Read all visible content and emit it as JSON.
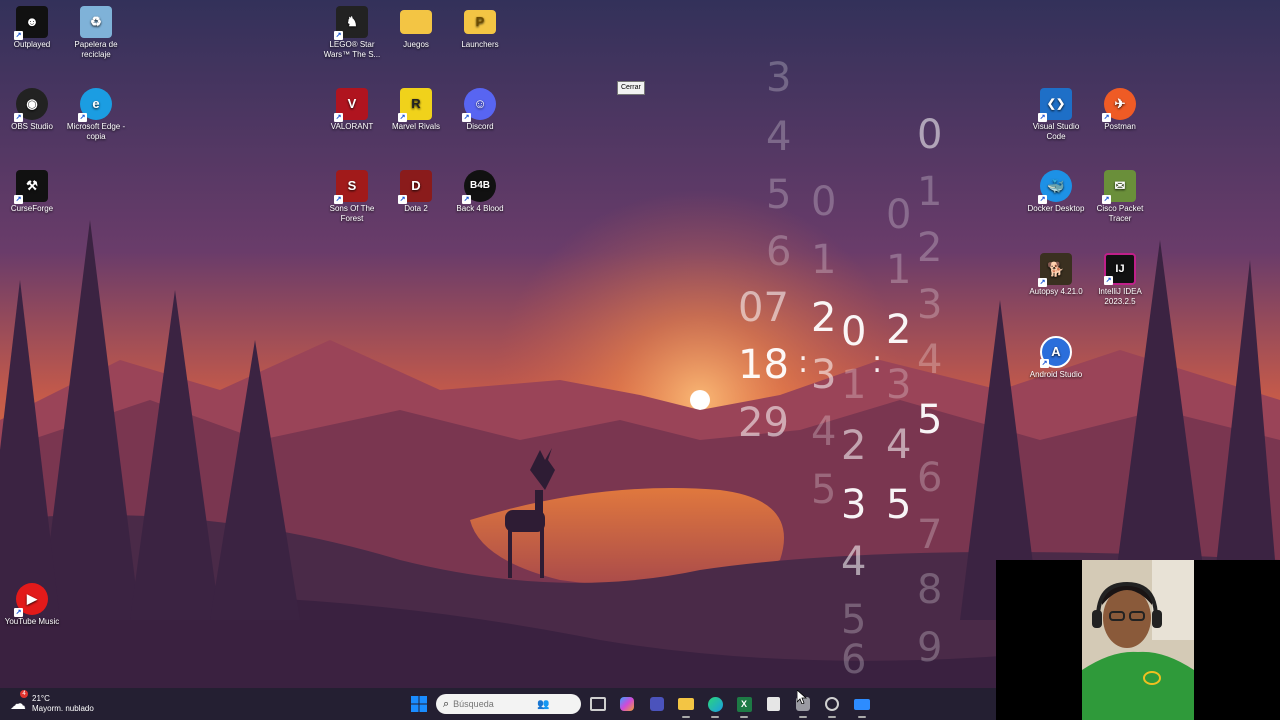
{
  "desktop": {
    "icons": [
      {
        "id": "outplayed",
        "label": "Outplayed",
        "glyph": "☻",
        "bg": "#111111"
      },
      {
        "id": "recycle",
        "label": "Papelera de reciclaje",
        "glyph": "♻",
        "bg": "#7fb2d8"
      },
      {
        "id": "obs",
        "label": "OBS Studio",
        "glyph": "◉",
        "bg": "#222222"
      },
      {
        "id": "edge-copy",
        "label": "Microsoft Edge - copia",
        "glyph": "e",
        "bg": "#1b9de2"
      },
      {
        "id": "curseforge",
        "label": "CurseForge",
        "glyph": "⚒",
        "bg": "#111111"
      },
      {
        "id": "lego",
        "label": "LEGO® Star Wars™ The S...",
        "glyph": "♞",
        "bg": "#222222"
      },
      {
        "id": "juegos",
        "label": "Juegos",
        "glyph": "",
        "bg": "#f3c544"
      },
      {
        "id": "launchers",
        "label": "Launchers",
        "glyph": "P",
        "bg": "#f3c544"
      },
      {
        "id": "valorant",
        "label": "VALORANT",
        "glyph": "V",
        "bg": "#b0141f"
      },
      {
        "id": "marvel",
        "label": "Marvel Rivals",
        "glyph": "R",
        "bg": "#f0d21b"
      },
      {
        "id": "discord",
        "label": "Discord",
        "glyph": "☺",
        "bg": "#5865f2"
      },
      {
        "id": "sons",
        "label": "Sons Of The Forest",
        "glyph": "S",
        "bg": "#a11a1a"
      },
      {
        "id": "dota",
        "label": "Dota 2",
        "glyph": "D",
        "bg": "#8a1b1b"
      },
      {
        "id": "b4b",
        "label": "Back 4 Blood",
        "glyph": "B4B",
        "bg": "#111111"
      },
      {
        "id": "vscode",
        "label": "Visual Studio Code",
        "glyph": "❮❯",
        "bg": "#1e6fc7"
      },
      {
        "id": "postman",
        "label": "Postman",
        "glyph": "✈",
        "bg": "#ef5b25"
      },
      {
        "id": "docker",
        "label": "Docker Desktop",
        "glyph": "🐳",
        "bg": "#1d91e6"
      },
      {
        "id": "cisco",
        "label": "Cisco Packet Tracer",
        "glyph": "✉",
        "bg": "#6a8f3a"
      },
      {
        "id": "autopsy",
        "label": "Autopsy 4.21.0",
        "glyph": "🐕",
        "bg": "#3a3020"
      },
      {
        "id": "intellij",
        "label": "IntelliJ IDEA 2023.2.5",
        "glyph": "IJ",
        "bg": "#111111"
      },
      {
        "id": "android",
        "label": "Android Studio",
        "glyph": "A",
        "bg": "#2b6edb"
      },
      {
        "id": "ytmusic",
        "label": "YouTube Music",
        "glyph": "▶",
        "bg": "#e21a1a"
      }
    ]
  },
  "tooltip": "Cerrar",
  "clock": {
    "hour": "18",
    "minute": "31",
    "second": "35",
    "hour_above": [
      "3",
      "4",
      "5",
      "6",
      "07"
    ],
    "hour_below": [
      "29"
    ],
    "col2": [
      "0",
      "1",
      "2",
      "3",
      "4",
      "5"
    ],
    "col3": [
      "0",
      "1",
      "2",
      "3",
      "4",
      "5"
    ],
    "col4": [
      "0",
      "1",
      "2",
      "3",
      "4",
      "5",
      "6"
    ],
    "col5": [
      "0",
      "1",
      "2",
      "3",
      "4",
      "5",
      "6",
      "7",
      "8",
      "9"
    ]
  },
  "taskbar": {
    "weather_temp": "21°C",
    "weather_desc": "Mayorm. nublado",
    "weather_badge": "4",
    "search_placeholder": "Búsqueda"
  },
  "colors": {
    "accent": "#1a8cff",
    "sun": "#ffffff"
  }
}
